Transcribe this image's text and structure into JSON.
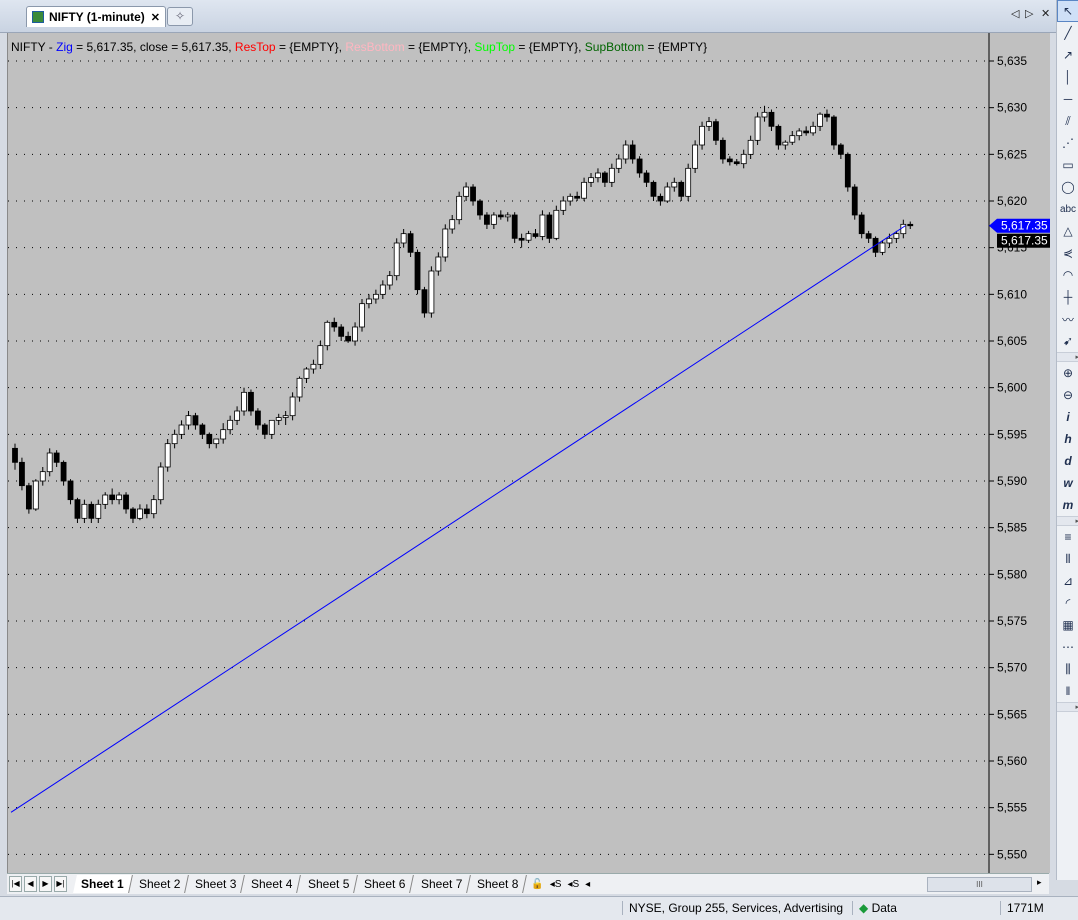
{
  "tab": {
    "title": "NIFTY (1-minute)",
    "close": "✕",
    "new_tab": "✧"
  },
  "window_controls": {
    "left": "◁",
    "right": "▷",
    "close": "✕"
  },
  "legend": [
    {
      "text": "NIFTY - ",
      "color": "#000000"
    },
    {
      "text": "Zig",
      "color": "#0000ff"
    },
    {
      "text": " = 5,617.35,  close = 5,617.35, ",
      "color": "#000000"
    },
    {
      "text": "ResTop",
      "color": "#ff0000"
    },
    {
      "text": " = {EMPTY}, ",
      "color": "#000000"
    },
    {
      "text": "ResBottom",
      "color": "#ffb6c1"
    },
    {
      "text": " = {EMPTY}, ",
      "color": "#000000"
    },
    {
      "text": "SupTop",
      "color": "#00ff00"
    },
    {
      "text": " = {EMPTY}, ",
      "color": "#000000"
    },
    {
      "text": "SupBottom",
      "color": "#006400"
    },
    {
      "text": " = {EMPTY}",
      "color": "#000000"
    }
  ],
  "chart_data": {
    "type": "candlestick",
    "symbol": "NIFTY",
    "interval": "1-minute",
    "ylim": [
      5548,
      5638
    ],
    "yticks": [
      "5,635",
      "5,630",
      "5,625",
      "5,620",
      "5,615",
      "5,610",
      "5,605",
      "5,600",
      "5,595",
      "5,590",
      "5,585",
      "5,580",
      "5,575",
      "5,570",
      "5,565",
      "5,560",
      "5,555",
      "5,550"
    ],
    "ytick_values": [
      5635,
      5630,
      5625,
      5620,
      5615,
      5610,
      5605,
      5600,
      5595,
      5590,
      5585,
      5580,
      5575,
      5570,
      5565,
      5560,
      5555,
      5550
    ],
    "candles": [
      [
        5593.5,
        5594.0,
        5591.2,
        5592.0
      ],
      [
        5592.0,
        5592.5,
        5589.0,
        5589.5
      ],
      [
        5589.5,
        5589.8,
        5586.5,
        5587.0
      ],
      [
        5587.0,
        5590.2,
        5586.8,
        5590.0
      ],
      [
        5590.0,
        5591.5,
        5589.5,
        5591.0
      ],
      [
        5591.0,
        5593.5,
        5590.5,
        5593.0
      ],
      [
        5593.0,
        5593.3,
        5591.5,
        5592.0
      ],
      [
        5592.0,
        5592.2,
        5589.5,
        5590.0
      ],
      [
        5590.0,
        5590.2,
        5587.5,
        5588.0
      ],
      [
        5588.0,
        5588.2,
        5585.5,
        5586.0
      ],
      [
        5586.0,
        5588.0,
        5585.5,
        5587.5
      ],
      [
        5587.5,
        5587.8,
        5585.5,
        5586.0
      ],
      [
        5586.0,
        5588.0,
        5585.5,
        5587.5
      ],
      [
        5587.5,
        5588.8,
        5587.0,
        5588.5
      ],
      [
        5588.5,
        5589.2,
        5587.5,
        5588.0
      ],
      [
        5588.0,
        5588.8,
        5587.5,
        5588.5
      ],
      [
        5588.5,
        5588.8,
        5586.5,
        5587.0
      ],
      [
        5587.0,
        5587.2,
        5585.5,
        5586.0
      ],
      [
        5586.0,
        5587.5,
        5585.8,
        5587.0
      ],
      [
        5587.0,
        5587.5,
        5586.0,
        5586.5
      ],
      [
        5586.5,
        5588.5,
        5586.0,
        5588.0
      ],
      [
        5588.0,
        5592.0,
        5587.5,
        5591.5
      ],
      [
        5591.5,
        5594.5,
        5591.0,
        5594.0
      ],
      [
        5594.0,
        5595.5,
        5593.5,
        5595.0
      ],
      [
        5595.0,
        5596.5,
        5594.5,
        5596.0
      ],
      [
        5596.0,
        5597.5,
        5595.5,
        5597.0
      ],
      [
        5597.0,
        5597.3,
        5595.5,
        5596.0
      ],
      [
        5596.0,
        5596.2,
        5594.5,
        5595.0
      ],
      [
        5595.0,
        5595.2,
        5593.5,
        5594.0
      ],
      [
        5594.0,
        5594.5,
        5593.5,
        5594.5
      ],
      [
        5594.5,
        5596.2,
        5594.0,
        5595.5
      ],
      [
        5595.5,
        5597.0,
        5595.0,
        5596.5
      ],
      [
        5596.5,
        5598.0,
        5596.0,
        5597.5
      ],
      [
        5597.5,
        5600.0,
        5597.0,
        5599.5
      ],
      [
        5599.5,
        5599.8,
        5597.0,
        5597.5
      ],
      [
        5597.5,
        5597.8,
        5595.5,
        5596.0
      ],
      [
        5596.0,
        5596.2,
        5594.5,
        5595.0
      ],
      [
        5595.0,
        5596.5,
        5594.5,
        5596.5
      ],
      [
        5596.5,
        5597.2,
        5596.0,
        5596.8
      ],
      [
        5596.8,
        5597.5,
        5596.0,
        5597.0
      ],
      [
        5597.0,
        5599.5,
        5596.5,
        5599.0
      ],
      [
        5599.0,
        5601.2,
        5598.5,
        5601.0
      ],
      [
        5601.0,
        5602.2,
        5600.5,
        5602.0
      ],
      [
        5602.0,
        5603.0,
        5601.5,
        5602.5
      ],
      [
        5602.5,
        5605.0,
        5602.0,
        5604.5
      ],
      [
        5604.5,
        5607.2,
        5604.0,
        5607.0
      ],
      [
        5607.0,
        5607.5,
        5606.0,
        5606.5
      ],
      [
        5606.5,
        5606.8,
        5605.0,
        5605.5
      ],
      [
        5605.5,
        5606.0,
        5604.8,
        5605.0
      ],
      [
        5605.0,
        5607.0,
        5604.5,
        5606.5
      ],
      [
        5606.5,
        5609.5,
        5606.0,
        5609.0
      ],
      [
        5609.0,
        5610.0,
        5608.5,
        5609.5
      ],
      [
        5609.5,
        5610.5,
        5609.0,
        5610.0
      ],
      [
        5610.0,
        5611.5,
        5609.5,
        5611.0
      ],
      [
        5611.0,
        5612.5,
        5610.5,
        5612.0
      ],
      [
        5612.0,
        5616.0,
        5611.5,
        5615.5
      ],
      [
        5615.5,
        5617.0,
        5615.0,
        5616.5
      ],
      [
        5616.5,
        5616.8,
        5614.0,
        5614.5
      ],
      [
        5614.5,
        5614.8,
        5610.0,
        5610.5
      ],
      [
        5610.5,
        5610.8,
        5607.5,
        5608.0
      ],
      [
        5608.0,
        5613.0,
        5607.5,
        5612.5
      ],
      [
        5612.5,
        5614.5,
        5612.0,
        5614.0
      ],
      [
        5614.0,
        5617.5,
        5613.5,
        5617.0
      ],
      [
        5617.0,
        5618.5,
        5616.5,
        5618.0
      ],
      [
        5618.0,
        5621.0,
        5617.5,
        5620.5
      ],
      [
        5620.5,
        5622.0,
        5620.0,
        5621.5
      ],
      [
        5621.5,
        5621.8,
        5619.5,
        5620.0
      ],
      [
        5620.0,
        5620.2,
        5618.0,
        5618.5
      ],
      [
        5618.5,
        5618.8,
        5617.0,
        5617.5
      ],
      [
        5617.5,
        5618.8,
        5617.0,
        5618.5
      ],
      [
        5618.5,
        5619.0,
        5618.0,
        5618.3
      ],
      [
        5618.3,
        5618.8,
        5617.8,
        5618.5
      ],
      [
        5618.5,
        5618.8,
        5615.5,
        5616.0
      ],
      [
        5616.0,
        5616.5,
        5615.0,
        5615.8
      ],
      [
        5615.8,
        5616.8,
        5615.5,
        5616.5
      ],
      [
        5616.5,
        5617.0,
        5616.0,
        5616.2
      ],
      [
        5616.2,
        5619.0,
        5615.8,
        5618.5
      ],
      [
        5618.5,
        5618.8,
        5615.5,
        5616.0
      ],
      [
        5616.0,
        5619.5,
        5615.8,
        5619.0
      ],
      [
        5619.0,
        5620.5,
        5618.5,
        5620.0
      ],
      [
        5620.0,
        5620.8,
        5619.5,
        5620.5
      ],
      [
        5620.5,
        5621.0,
        5620.0,
        5620.3
      ],
      [
        5620.3,
        5622.5,
        5620.0,
        5622.0
      ],
      [
        5622.0,
        5623.0,
        5621.5,
        5622.5
      ],
      [
        5622.5,
        5623.5,
        5622.0,
        5623.0
      ],
      [
        5623.0,
        5623.2,
        5621.5,
        5622.0
      ],
      [
        5622.0,
        5624.0,
        5621.5,
        5623.5
      ],
      [
        5623.5,
        5625.0,
        5623.0,
        5624.5
      ],
      [
        5624.5,
        5626.5,
        5624.0,
        5626.0
      ],
      [
        5626.0,
        5626.5,
        5624.0,
        5624.5
      ],
      [
        5624.5,
        5624.8,
        5622.5,
        5623.0
      ],
      [
        5623.0,
        5623.3,
        5621.5,
        5622.0
      ],
      [
        5622.0,
        5622.2,
        5620.0,
        5620.5
      ],
      [
        5620.5,
        5620.8,
        5619.5,
        5620.0
      ],
      [
        5620.0,
        5622.0,
        5619.8,
        5621.5
      ],
      [
        5621.5,
        5622.5,
        5621.0,
        5622.0
      ],
      [
        5622.0,
        5622.2,
        5620.0,
        5620.5
      ],
      [
        5620.5,
        5624.0,
        5620.0,
        5623.5
      ],
      [
        5623.5,
        5626.5,
        5623.0,
        5626.0
      ],
      [
        5626.0,
        5628.5,
        5625.5,
        5628.0
      ],
      [
        5628.0,
        5629.0,
        5627.5,
        5628.5
      ],
      [
        5628.5,
        5628.8,
        5626.0,
        5626.5
      ],
      [
        5626.5,
        5626.8,
        5624.0,
        5624.5
      ],
      [
        5624.5,
        5624.8,
        5623.8,
        5624.2
      ],
      [
        5624.2,
        5624.5,
        5623.8,
        5624.0
      ],
      [
        5624.0,
        5625.5,
        5623.5,
        5625.0
      ],
      [
        5625.0,
        5627.0,
        5624.5,
        5626.5
      ],
      [
        5626.5,
        5629.5,
        5626.0,
        5629.0
      ],
      [
        5629.0,
        5630.2,
        5628.5,
        5629.5
      ],
      [
        5629.5,
        5629.8,
        5627.5,
        5628.0
      ],
      [
        5628.0,
        5628.2,
        5625.5,
        5626.0
      ],
      [
        5626.0,
        5626.5,
        5625.5,
        5626.3
      ],
      [
        5626.3,
        5627.5,
        5626.0,
        5627.0
      ],
      [
        5627.0,
        5627.8,
        5626.5,
        5627.5
      ],
      [
        5627.5,
        5628.0,
        5627.0,
        5627.3
      ],
      [
        5627.3,
        5628.5,
        5627.0,
        5628.0
      ],
      [
        5628.0,
        5629.5,
        5627.5,
        5629.3
      ],
      [
        5629.3,
        5629.8,
        5628.5,
        5629.0
      ],
      [
        5629.0,
        5629.2,
        5625.5,
        5626.0
      ],
      [
        5626.0,
        5626.2,
        5624.5,
        5625.0
      ],
      [
        5625.0,
        5625.2,
        5621.0,
        5621.5
      ],
      [
        5621.5,
        5621.8,
        5618.0,
        5618.5
      ],
      [
        5618.5,
        5618.8,
        5616.0,
        5616.5
      ],
      [
        5616.5,
        5616.8,
        5615.5,
        5616.0
      ],
      [
        5616.0,
        5616.2,
        5614.0,
        5614.5
      ],
      [
        5614.5,
        5615.8,
        5614.2,
        5615.5
      ],
      [
        5615.5,
        5616.5,
        5615.0,
        5616.0
      ],
      [
        5616.0,
        5616.8,
        5615.5,
        5616.5
      ],
      [
        5616.5,
        5618.0,
        5616.0,
        5617.5
      ],
      [
        5617.5,
        5617.8,
        5617.0,
        5617.35
      ]
    ],
    "zig": {
      "label": "Zig",
      "color": "#0000ff",
      "points": [
        [
          0,
          5554.5
        ],
        [
          128,
          5617.35
        ]
      ]
    },
    "last_price": {
      "label": "5,617.35",
      "value": 5617.35,
      "bg": "#0000ff"
    },
    "close_price": {
      "label": "5,617.35",
      "value": 5617.35,
      "bg": "#000000"
    },
    "grid": "dotted",
    "background": "#c0c0c0"
  },
  "toolbar_tools": [
    {
      "name": "select-tool",
      "glyph": "↖"
    },
    {
      "name": "line-tool",
      "glyph": "╱"
    },
    {
      "name": "ray-tool",
      "glyph": "↗"
    },
    {
      "name": "vertical-line-tool",
      "glyph": "│"
    },
    {
      "name": "horizontal-line-tool",
      "glyph": "─"
    },
    {
      "name": "channel-tool",
      "glyph": "⫽"
    },
    {
      "name": "fib-fan-tool",
      "glyph": "⋰"
    },
    {
      "name": "rectangle-tool",
      "glyph": "▭"
    },
    {
      "name": "ellipse-tool",
      "glyph": "◯"
    },
    {
      "name": "text-tool",
      "glyph": "abc"
    },
    {
      "name": "triangle-tool",
      "glyph": "△"
    },
    {
      "name": "fork-tool",
      "glyph": "⋞"
    },
    {
      "name": "arc-tool",
      "glyph": "◠"
    },
    {
      "name": "cycle-tool",
      "glyph": "┼"
    },
    {
      "name": "zigzag-tool",
      "glyph": "〰"
    },
    {
      "name": "arrow-tool",
      "glyph": "➹"
    },
    {
      "sep": true
    },
    {
      "name": "zoom-in-tool",
      "glyph": "⊕"
    },
    {
      "name": "zoom-out-tool",
      "glyph": "⊖"
    },
    {
      "name": "interval-intraday-tool",
      "glyph": "i"
    },
    {
      "name": "interval-hourly-tool",
      "glyph": "h"
    },
    {
      "name": "interval-daily-tool",
      "glyph": "d"
    },
    {
      "name": "interval-weekly-tool",
      "glyph": "w"
    },
    {
      "name": "interval-monthly-tool",
      "glyph": "m"
    },
    {
      "sep": true
    },
    {
      "name": "fib-retracement-tool",
      "glyph": "≡"
    },
    {
      "name": "fib-extension-tool",
      "glyph": "⦀"
    },
    {
      "name": "gann-fan-tool",
      "glyph": "⊿"
    },
    {
      "name": "fib-arc-tool",
      "glyph": "◜"
    },
    {
      "name": "gann-grid-tool",
      "glyph": "▦"
    },
    {
      "name": "speed-lines-tool",
      "glyph": "⋯"
    },
    {
      "name": "fib-timezone-tool",
      "glyph": "⫼"
    },
    {
      "name": "cycle-lines-tool",
      "glyph": "‖"
    },
    {
      "sep": true
    }
  ],
  "sheet_bar": {
    "nav": [
      "|◀",
      "◀",
      "▶",
      "▶|"
    ],
    "tabs": [
      "Sheet 1",
      "Sheet 2",
      "Sheet 3",
      "Sheet 4",
      "Sheet 5",
      "Sheet 6",
      "Sheet 7",
      "Sheet 8"
    ],
    "active": 0,
    "extras": [
      "🔓",
      "◂S",
      "◂S",
      "◂"
    ],
    "scroll_grip": "III",
    "scroll_right": "▸"
  },
  "status_bar": {
    "symbol_info": "NYSE, Group 255, Services, Advertising",
    "data_label": "Data",
    "memory": "1771M"
  }
}
